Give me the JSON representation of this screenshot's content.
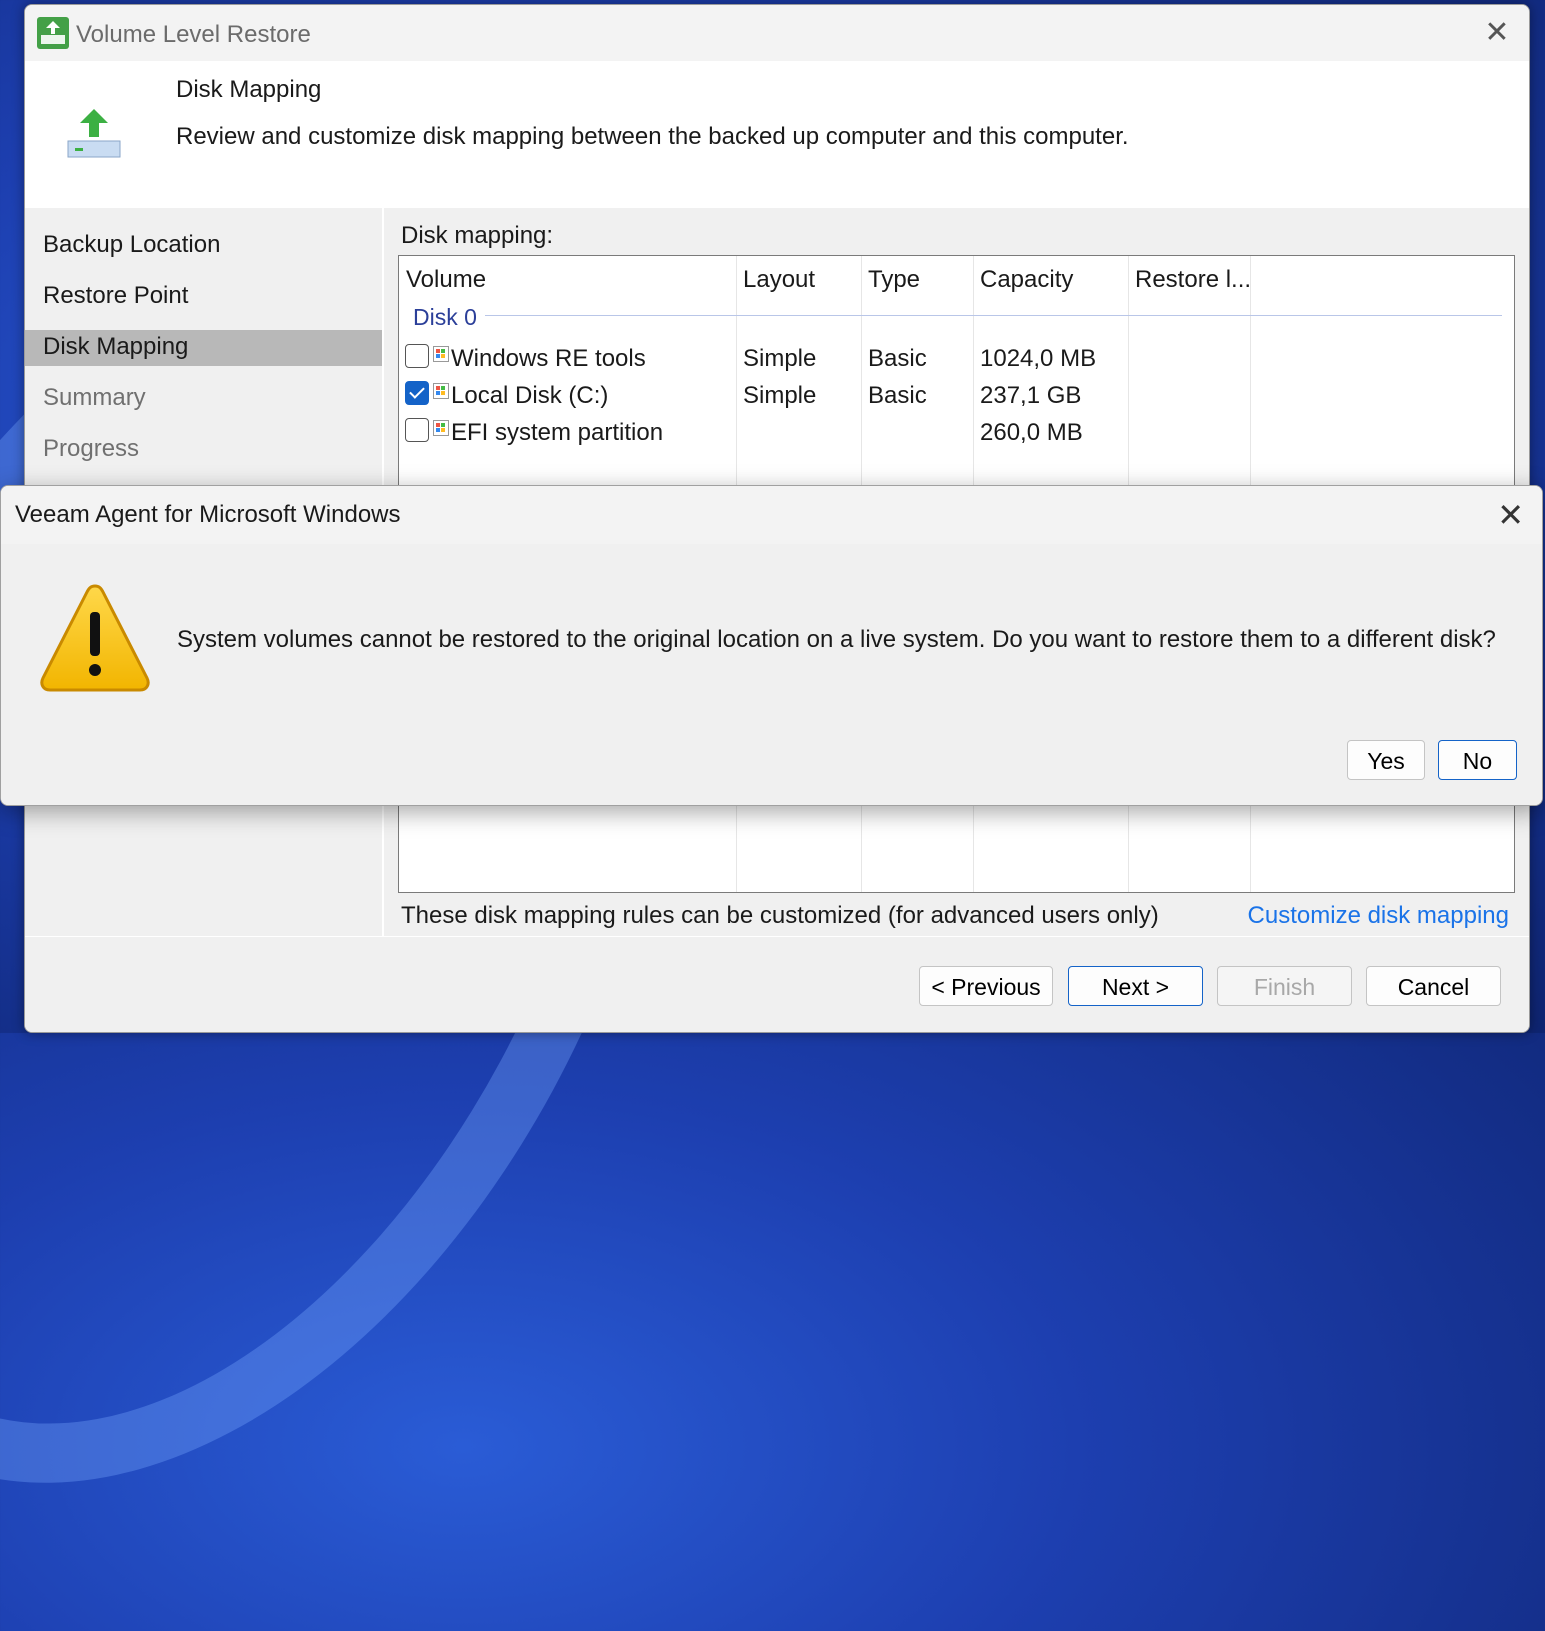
{
  "wizard": {
    "title": "Volume Level Restore",
    "close_glyph": "✕",
    "header": {
      "title": "Disk Mapping",
      "description": "Review and customize disk mapping between the backed up computer and this computer.",
      "icon": "restore-upload-icon"
    },
    "steps": [
      {
        "label": "Backup Location",
        "state": "done"
      },
      {
        "label": "Restore Point",
        "state": "done"
      },
      {
        "label": "Disk Mapping",
        "state": "active"
      },
      {
        "label": "Summary",
        "state": "disabled"
      },
      {
        "label": "Progress",
        "state": "disabled"
      }
    ],
    "disk_mapping_label": "Disk mapping:",
    "columns": [
      "Volume",
      "Layout",
      "Type",
      "Capacity",
      "Restore l..."
    ],
    "disk_group": "Disk 0",
    "volumes": [
      {
        "name": "Windows RE tools",
        "layout": "Simple",
        "type": "Basic",
        "capacity": "1024,0 MB",
        "checked": false
      },
      {
        "name": "Local Disk (C:)",
        "layout": "Simple",
        "type": "Basic",
        "capacity": "237,1 GB",
        "checked": true
      },
      {
        "name": "EFI system partition",
        "layout": "",
        "type": "",
        "capacity": "260,0 MB",
        "checked": false
      }
    ],
    "rules_text": "These disk mapping rules can be customized (for advanced users only)",
    "customize_link": "Customize disk mapping",
    "buttons": {
      "previous": "< Previous",
      "next": "Next >",
      "finish": "Finish",
      "cancel": "Cancel"
    }
  },
  "message_box": {
    "title": "Veeam Agent for Microsoft Windows",
    "close_glyph": "✕",
    "icon": "warning-icon",
    "text": "System volumes cannot be restored to the original location on a live system. Do you want to restore them to a different disk?",
    "buttons": {
      "yes": "Yes",
      "no": "No"
    }
  },
  "colors": {
    "accent": "#1463c8",
    "link": "#1a73e8",
    "active_step": "#b8b8b8",
    "warning": "#f5c400"
  }
}
